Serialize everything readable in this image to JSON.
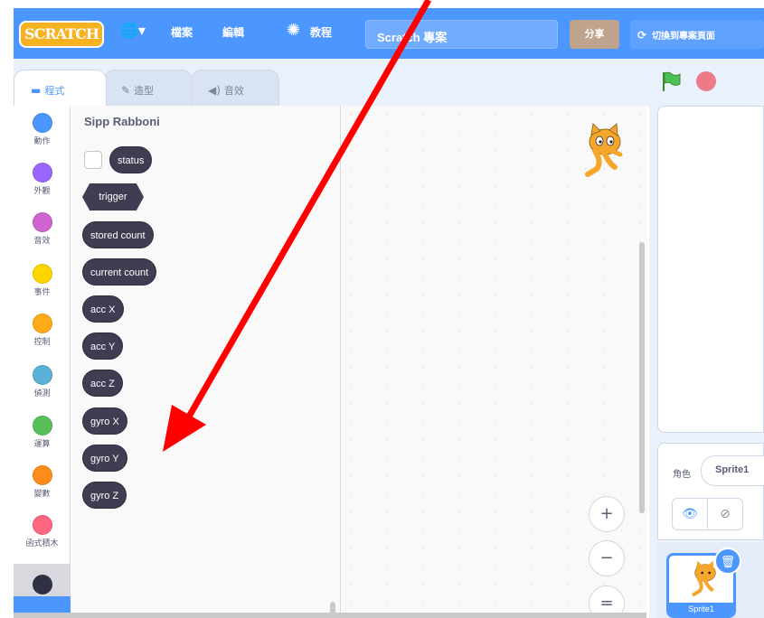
{
  "menubar": {
    "logo": "SCRATCH",
    "file_menu": "檔案",
    "edit_menu": "編輯",
    "tutorials": "教程",
    "project_title": "Scratch 專案",
    "share": "分享",
    "see_project_page": "切換到專案頁面"
  },
  "tabs": [
    {
      "label": "程式",
      "icon": "code-icon"
    },
    {
      "label": "造型",
      "icon": "brush-icon"
    },
    {
      "label": "音效",
      "icon": "speaker-icon"
    }
  ],
  "categories": [
    {
      "label": "動作",
      "color": "#4c97ff"
    },
    {
      "label": "外觀",
      "color": "#9966ff"
    },
    {
      "label": "音效",
      "color": "#cf63cf"
    },
    {
      "label": "事件",
      "color": "#ffd500"
    },
    {
      "label": "控制",
      "color": "#ffab19"
    },
    {
      "label": "偵測",
      "color": "#5cb1d6"
    },
    {
      "label": "運算",
      "color": "#59c059"
    },
    {
      "label": "變數",
      "color": "#ff8c1a"
    },
    {
      "label": "函式積木",
      "color": "#ff6680"
    }
  ],
  "extension": {
    "title": "Sipp Rabboni",
    "color": "#403d52",
    "blocks": [
      "status",
      "trigger",
      "stored count",
      "current count",
      "acc X",
      "acc Y",
      "acc Z",
      "gyro X",
      "gyro Y",
      "gyro Z"
    ]
  },
  "zoom": {
    "in": "+",
    "out": "−",
    "reset": "="
  },
  "sprite": {
    "label": "角色",
    "name": "Sprite1",
    "thumb_label": "Sprite1"
  },
  "annotation": {
    "arrow_color": "#ff0000"
  }
}
